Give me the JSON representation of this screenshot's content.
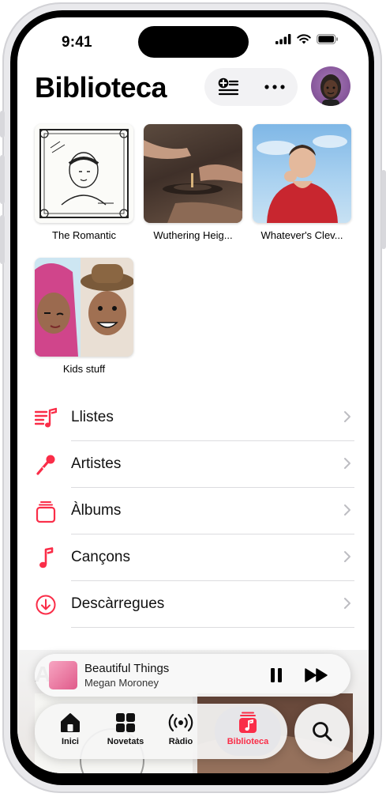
{
  "status_bar": {
    "time": "9:41"
  },
  "header": {
    "title": "Biblioteca"
  },
  "albums": [
    {
      "title": "The Romantic"
    },
    {
      "title": "Wuthering Heig..."
    },
    {
      "title": "Whatever's Clev..."
    },
    {
      "title": "Kids stuff"
    }
  ],
  "menu": [
    {
      "label": "Llistes",
      "icon": "playlist-icon"
    },
    {
      "label": "Artistes",
      "icon": "microphone-icon"
    },
    {
      "label": "Àlbums",
      "icon": "album-stack-icon"
    },
    {
      "label": "Cançons",
      "icon": "music-note-icon"
    },
    {
      "label": "Descàrregues",
      "icon": "download-icon"
    }
  ],
  "now_playing": {
    "song": "Beautiful Things",
    "artist": "Megan Moroney"
  },
  "tabs": [
    {
      "label": "Inici",
      "icon": "home-icon"
    },
    {
      "label": "Novetats",
      "icon": "grid-icon"
    },
    {
      "label": "Ràdio",
      "icon": "radio-icon"
    },
    {
      "label": "Biblioteca",
      "icon": "library-icon",
      "active": true
    }
  ],
  "colors": {
    "accent": "#fa2d48",
    "text": "#000000",
    "separator": "#dcdcdf"
  }
}
